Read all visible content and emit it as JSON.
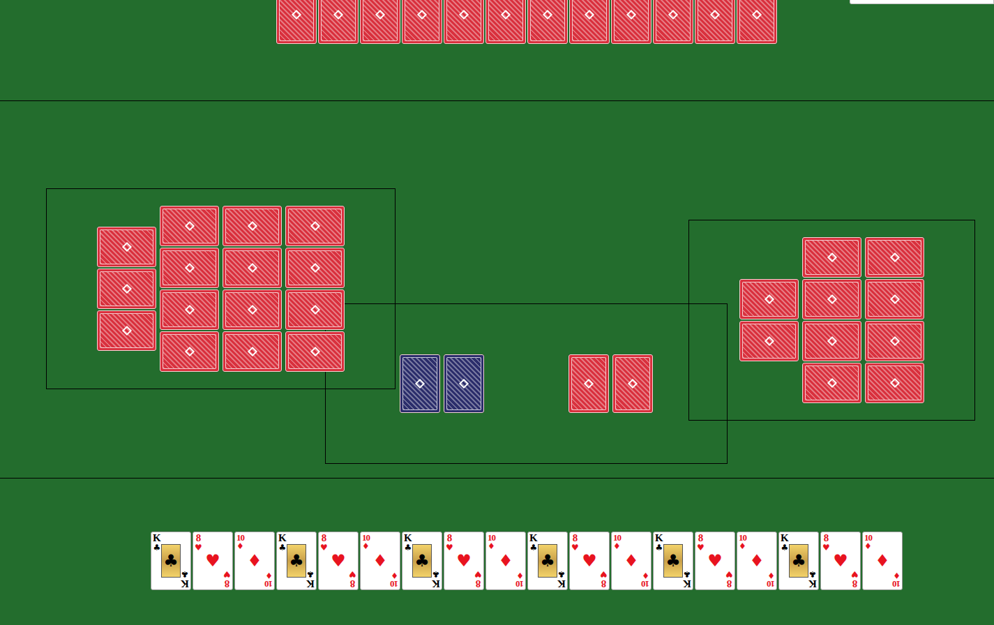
{
  "top_hand": {
    "cards": [
      {
        "color": "#d9303d"
      },
      {
        "color": "#d9303d"
      },
      {
        "color": "#d9303d"
      },
      {
        "color": "#d9303d"
      },
      {
        "color": "#d9303d"
      },
      {
        "color": "#d9303d"
      },
      {
        "color": "#d9303d"
      },
      {
        "color": "#d9303d"
      },
      {
        "color": "#d9303d"
      },
      {
        "color": "#d9303d"
      },
      {
        "color": "#d9303d"
      },
      {
        "color": "#d9303d"
      }
    ]
  },
  "left_area": {
    "columns": [
      [
        {
          "color": "#d9303d"
        },
        {
          "color": "#d9303d"
        },
        {
          "color": "#d9303d"
        }
      ],
      [
        {
          "color": "#d9303d"
        },
        {
          "color": "#d9303d"
        },
        {
          "color": "#d9303d"
        },
        {
          "color": "#d9303d"
        }
      ],
      [
        {
          "color": "#d9303d"
        },
        {
          "color": "#d9303d"
        },
        {
          "color": "#d9303d"
        },
        {
          "color": "#d9303d"
        }
      ],
      [
        {
          "color": "#d9303d"
        },
        {
          "color": "#d9303d"
        },
        {
          "color": "#d9303d"
        },
        {
          "color": "#d9303d"
        }
      ]
    ]
  },
  "right_area": {
    "columns": [
      [
        {
          "color": "#d9303d"
        },
        {
          "color": "#d9303d"
        }
      ],
      [
        {
          "color": "#d9303d"
        },
        {
          "color": "#d9303d"
        },
        {
          "color": "#d9303d"
        },
        {
          "color": "#d9303d"
        }
      ],
      [
        {
          "color": "#d9303d"
        },
        {
          "color": "#d9303d"
        },
        {
          "color": "#d9303d"
        },
        {
          "color": "#d9303d"
        }
      ]
    ]
  },
  "trick": {
    "groups": [
      {
        "cards": [
          {
            "color": "#2b2d6b"
          },
          {
            "color": "#2b2d6b"
          }
        ]
      },
      {
        "cards": [
          {
            "color": "#d9303d"
          },
          {
            "color": "#d9303d"
          }
        ]
      }
    ]
  },
  "hand": {
    "cards": [
      {
        "rank": "K",
        "suit": "♣",
        "color": "#000000",
        "kind": "face"
      },
      {
        "rank": "8",
        "suit": "♥",
        "color": "#e8131f",
        "kind": "pip"
      },
      {
        "rank": "10",
        "suit": "♦",
        "color": "#e8131f",
        "kind": "pip"
      },
      {
        "rank": "K",
        "suit": "♣",
        "color": "#000000",
        "kind": "face"
      },
      {
        "rank": "8",
        "suit": "♥",
        "color": "#e8131f",
        "kind": "pip"
      },
      {
        "rank": "10",
        "suit": "♦",
        "color": "#e8131f",
        "kind": "pip"
      },
      {
        "rank": "K",
        "suit": "♣",
        "color": "#000000",
        "kind": "face"
      },
      {
        "rank": "8",
        "suit": "♥",
        "color": "#e8131f",
        "kind": "pip"
      },
      {
        "rank": "10",
        "suit": "♦",
        "color": "#e8131f",
        "kind": "pip"
      },
      {
        "rank": "K",
        "suit": "♣",
        "color": "#000000",
        "kind": "face"
      },
      {
        "rank": "8",
        "suit": "♥",
        "color": "#e8131f",
        "kind": "pip"
      },
      {
        "rank": "10",
        "suit": "♦",
        "color": "#e8131f",
        "kind": "pip"
      },
      {
        "rank": "K",
        "suit": "♣",
        "color": "#000000",
        "kind": "face"
      },
      {
        "rank": "8",
        "suit": "♥",
        "color": "#e8131f",
        "kind": "pip"
      },
      {
        "rank": "10",
        "suit": "♦",
        "color": "#e8131f",
        "kind": "pip"
      },
      {
        "rank": "K",
        "suit": "♣",
        "color": "#000000",
        "kind": "face"
      },
      {
        "rank": "8",
        "suit": "♥",
        "color": "#e8131f",
        "kind": "pip"
      },
      {
        "rank": "10",
        "suit": "♦",
        "color": "#e8131f",
        "kind": "pip"
      }
    ]
  }
}
